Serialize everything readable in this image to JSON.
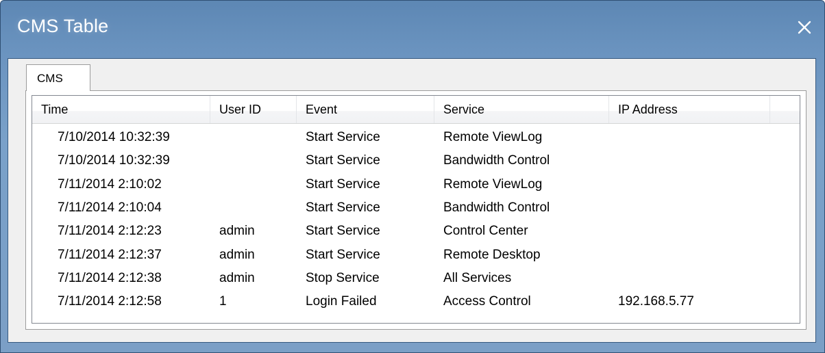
{
  "window": {
    "title": "CMS Table",
    "close_glyph": "✕"
  },
  "tabs": [
    {
      "label": "CMS",
      "active": true
    }
  ],
  "table": {
    "columns": [
      "Time",
      "User ID",
      "Event",
      "Service",
      "IP Address"
    ],
    "rows": [
      {
        "time": "7/10/2014 10:32:39",
        "user_id": "",
        "event": "Start Service",
        "service": "Remote ViewLog",
        "ip": ""
      },
      {
        "time": "7/10/2014 10:32:39",
        "user_id": "",
        "event": "Start Service",
        "service": "Bandwidth Control",
        "ip": ""
      },
      {
        "time": "7/11/2014 2:10:02",
        "user_id": "",
        "event": "Start Service",
        "service": "Remote ViewLog",
        "ip": ""
      },
      {
        "time": "7/11/2014 2:10:04",
        "user_id": "",
        "event": "Start Service",
        "service": "Bandwidth Control",
        "ip": ""
      },
      {
        "time": "7/11/2014 2:12:23",
        "user_id": "admin",
        "event": "Start Service",
        "service": "Control Center",
        "ip": ""
      },
      {
        "time": "7/11/2014 2:12:37",
        "user_id": "admin",
        "event": "Start Service",
        "service": "Remote Desktop",
        "ip": ""
      },
      {
        "time": "7/11/2014 2:12:38",
        "user_id": "admin",
        "event": "Stop Service",
        "service": "All Services",
        "ip": ""
      },
      {
        "time": "7/11/2014 2:12:58",
        "user_id": "1",
        "event": "Login Failed",
        "service": "Access Control",
        "ip": "192.168.5.77"
      }
    ]
  },
  "icons": {
    "close": "close-icon"
  },
  "colors": {
    "titlebar": "#6a93bf",
    "window_frame": "#7b9fc6",
    "client_bg": "#f0f0f0",
    "list_bg": "#ffffff"
  }
}
